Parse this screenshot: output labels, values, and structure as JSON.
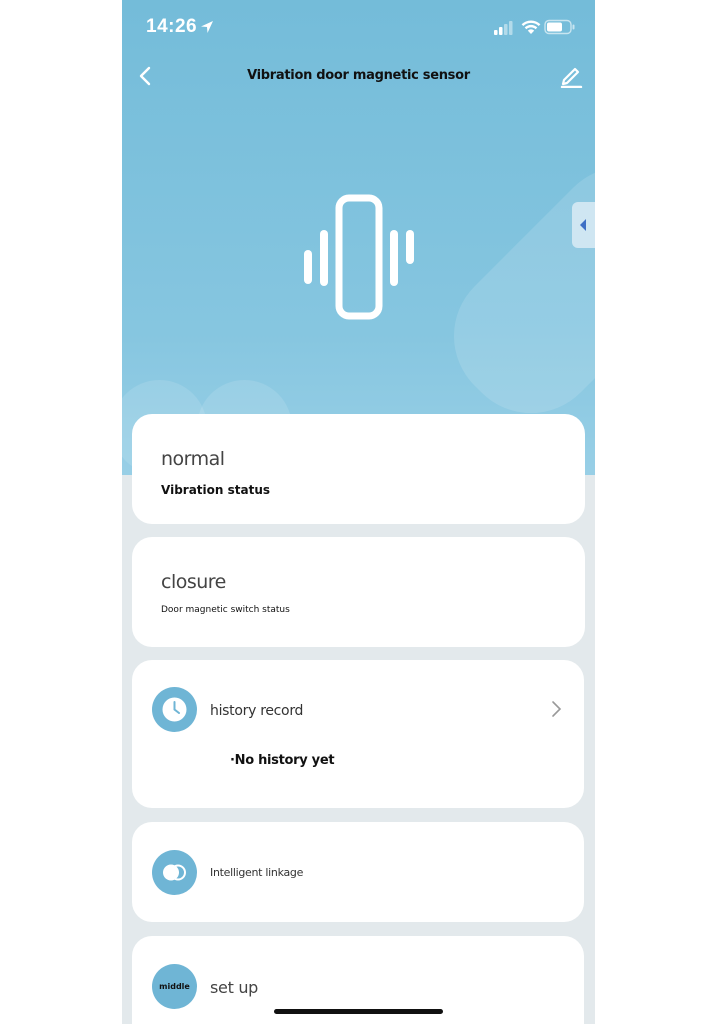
{
  "status_bar": {
    "time": "14:26"
  },
  "header": {
    "title": "Vibration door magnetic sensor"
  },
  "vibration": {
    "value": "normal",
    "label": "Vibration status"
  },
  "door": {
    "value": "closure",
    "label": "Door magnetic switch status"
  },
  "history": {
    "label": "history record",
    "empty_text": "·No history yet"
  },
  "linkage": {
    "label": "Intelligent linkage"
  },
  "setup": {
    "icon_text": "middle",
    "label": "set up"
  },
  "icons": {
    "back": "chevron-left-icon",
    "edit": "pencil-icon",
    "history": "clock-icon",
    "linkage": "toggle-icon",
    "panel": "triangle-left-icon"
  },
  "colors": {
    "hero": "#7bbfdb",
    "accent": "#6fb5d5",
    "background": "#e3e9ec"
  }
}
